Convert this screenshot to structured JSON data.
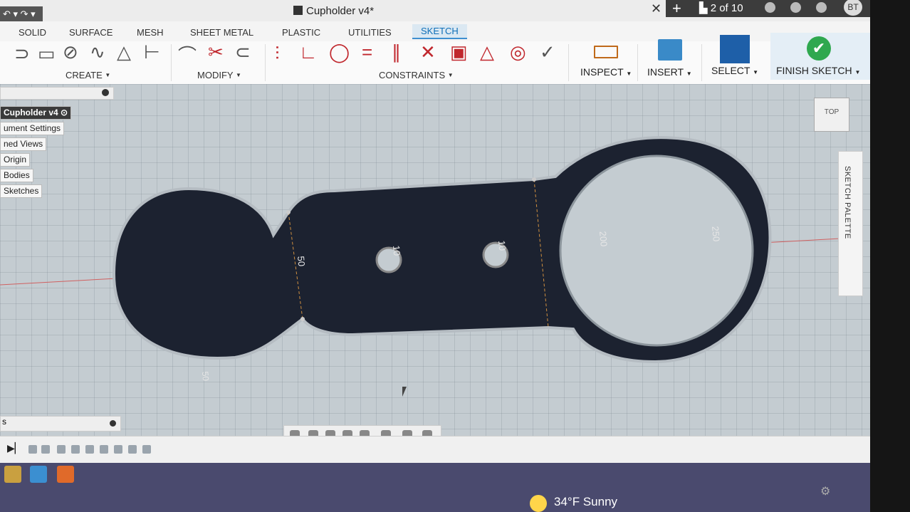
{
  "window": {
    "title": "Cupholder v4*",
    "page_indicator": "2 of 10",
    "user_initials": "BT",
    "undo_label": "↶ ▾ ↷ ▾"
  },
  "tabs": [
    {
      "label": "SOLID"
    },
    {
      "label": "SURFACE"
    },
    {
      "label": "MESH"
    },
    {
      "label": "SHEET METAL"
    },
    {
      "label": "PLASTIC"
    },
    {
      "label": "UTILITIES"
    },
    {
      "label": "SKETCH",
      "active": true
    }
  ],
  "ribbon": {
    "create_label": "CREATE",
    "modify_label": "MODIFY",
    "constraints_label": "CONSTRAINTS",
    "inspect_label": "INSPECT",
    "insert_label": "INSERT",
    "select_label": "SELECT",
    "finish_label": "FINISH SKETCH"
  },
  "browser": {
    "nodes": [
      {
        "label": "Cupholder v4"
      },
      {
        "label": "ument Settings"
      },
      {
        "label": "ned Views"
      },
      {
        "label": "Origin"
      },
      {
        "label": "Bodies"
      },
      {
        "label": "Sketches"
      }
    ]
  },
  "viewcube": {
    "label": "TOP"
  },
  "palette": {
    "label": "SKETCH PALETTE"
  },
  "dimensions": {
    "slot_width": "50",
    "hole_left": "10",
    "hole_right": "10",
    "inner_circle": "200",
    "outer_circle": "250",
    "bottom_axis": "50"
  },
  "comments": {
    "label": "s"
  },
  "taskbar": {
    "weather": "34°F  Sunny"
  },
  "colors": {
    "sketch_fill": "#1c2230",
    "accent_blue": "#0f6fb8",
    "finish_green": "#2fa84f"
  }
}
